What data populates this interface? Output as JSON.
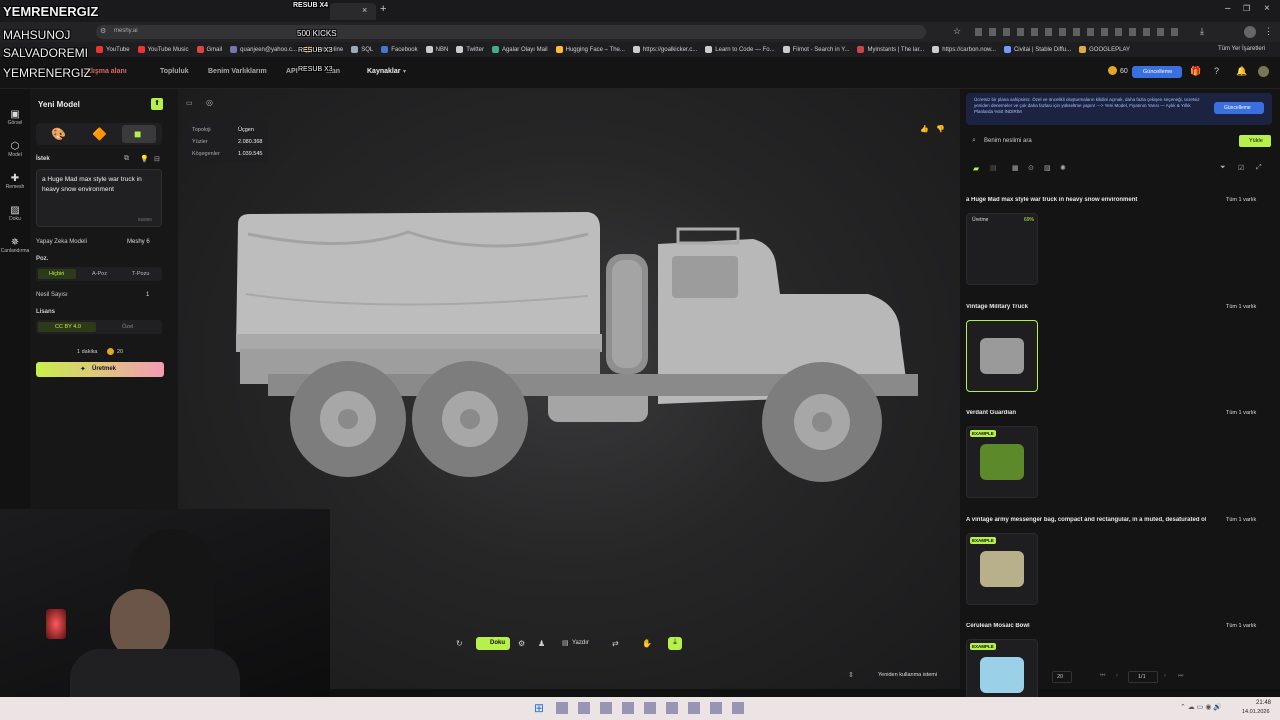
{
  "stream_overlay": {
    "line1": "YEMRENERGIZ",
    "line2": "MAHSUNOJ",
    "line3": "SALVADOREMI",
    "line4": "YEMRENERGIZ",
    "top_right": "RESUB X4",
    "kicks": "500 KICKS",
    "resub_a": "RESUB X3",
    "resub_b": "RESUB X3"
  },
  "browser": {
    "url": "meshy.ai",
    "bookmarks": [
      "YouTube",
      "YouTube Music",
      "Gmail",
      "quanjeen@yahoo.c...",
      "Webonline",
      "SQL",
      "Facebook",
      "NBN",
      "Twitter",
      "Agalar Olayı Mail",
      "Hugging Face – The...",
      "https://goalkicker.c...",
      "Learn to Code — Fo...",
      "Filmot - Search in Y...",
      "Myinstants | The lar...",
      "https://carbon.now...",
      "Civitai | Stable Diffu...",
      "GOOGLEPLAY"
    ],
    "all_bookmarks": "Tüm Yer İşaretleri",
    "bookmark_colors": [
      "#e33",
      "#e33",
      "#d44",
      "#77a",
      "#c93",
      "#9ab",
      "#47c",
      "#ccc",
      "#ccc",
      "#4a8",
      "#fb3",
      "#ccc",
      "#ccc",
      "#ccc",
      "#c44",
      "#ccc",
      "#79f",
      "#da4"
    ]
  },
  "nav": {
    "items": [
      "Çalışma alanı",
      "Topluluk",
      "Benim Varlıklarım",
      "API",
      "...an",
      "Kaynaklar"
    ],
    "credits": "60",
    "upgrade": "Güncelleme"
  },
  "rail": [
    {
      "icon": "image-icon",
      "label": "Görsel"
    },
    {
      "icon": "cube-icon",
      "label": "Model"
    },
    {
      "icon": "remesh-icon",
      "label": "Remesh"
    },
    {
      "icon": "texture-icon",
      "label": "Doku"
    },
    {
      "icon": "animate-icon",
      "label": "Canlandırma"
    }
  ],
  "panel": {
    "title": "Yeni Model",
    "prompt_label": "İstek",
    "prompt_text": "a Huge Mad max style war truck in heavy snow environment",
    "char_count": "55/800",
    "ai_model_label": "Yapay Zeka Modeli",
    "ai_model_value": "Meshy 6",
    "pose_label": "Poz.",
    "pose_options": [
      "Hiçbiri",
      "A-Poz",
      "T-Pozu"
    ],
    "gen_count_label": "Nesil Sayısı",
    "gen_count_value": "1",
    "license_label": "Lisans",
    "license_options": [
      "CC BY 4.0",
      "Özel"
    ],
    "time": "1 dakika",
    "cost": "20",
    "generate": "Üretmek"
  },
  "viewer": {
    "stats": [
      {
        "k": "Topoloji",
        "v": "Üçgen"
      },
      {
        "k": "Yüzler",
        "v": "2.080.368"
      },
      {
        "k": "Köşegenler",
        "v": "1.039.545"
      }
    ],
    "toolbar": [
      "Doku",
      "Yazdır"
    ],
    "reuse": "Yeniden kullanma istemi"
  },
  "right": {
    "promo": "Ücretsiz bir plana sahipsiniz. Özel ve öncelikli oluşturmaların kilidini açmak, daha fazla çekişen seçeneği, ücretsiz yeniden denemeler ve çok daha fazlası için yükseltme yapın! ---> Yeni Model, Fiyatının Yarısı — Aylık & Yıllık Planlarda %50 İNDİRİM",
    "promo_button": "Güncelleme",
    "search_placeholder": "Benim neslimi ara",
    "upload": "Yükle",
    "sections": [
      {
        "title": "a Huge Mad max style war truck in heavy snow environment",
        "all": "Tüm 1 varlık",
        "status": "Üretme",
        "pct": "69%"
      },
      {
        "title": "Vintage Military Truck",
        "all": "Tüm 1 varlık"
      },
      {
        "title": "Verdant Guardian",
        "all": "Tüm 1 varlık",
        "badge": "EXAMPLE"
      },
      {
        "title": "A vintage army messenger bag, compact and rectangular, in a muted, desaturated olive g...",
        "all": "Tüm 1 varlık",
        "badge": "EXAMPLE"
      },
      {
        "title": "Cerulean Mosaic Bowl",
        "all": "Tüm 1 varlık",
        "badge": "EXAMPLE"
      }
    ],
    "page_size": "20",
    "page": "1/1"
  },
  "clock": {
    "time": "21:48",
    "date": "14.01.2026"
  }
}
